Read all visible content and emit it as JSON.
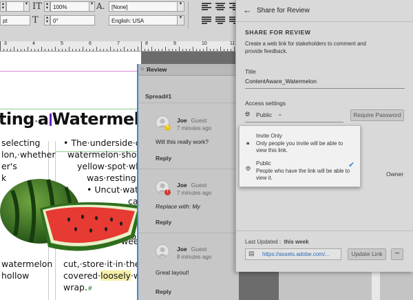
{
  "toolbar": {
    "size_value": "pt",
    "tracking_value": "100%",
    "scale_value": "100%",
    "skew_value": "0°",
    "style_value": "[None]",
    "language_value": "English: USA"
  },
  "ruler": {
    "numbers": [
      "3",
      "4",
      "5",
      "6",
      "7",
      "8",
      "9",
      "10",
      "11",
      "12"
    ]
  },
  "document": {
    "headline_left": "ting",
    "headline_mid": "a",
    "headline_right": "Watermelon",
    "col1": [
      "selecting",
      "lon,·whether",
      "er's",
      "k",
      "watermelon",
      "hollow"
    ],
    "col2": [
      "• The·underside·of·th",
      "watermelon·should",
      "yellow·spot·where",
      "was·resting·on",
      "• Uncut·water",
      "ca",
      "tem",
      "mo",
      "fo",
      "wee",
      "cut,·store·it·in·the·re",
      "covered",
      "loosely",
      "with",
      "wrap."
    ]
  },
  "review": {
    "title": "Review",
    "spread": "Spread#1",
    "comments": [
      {
        "name": "Joe",
        "role": "Guest",
        "time": "7 minutes ago",
        "text": "Will this really work?",
        "reply": "Reply"
      },
      {
        "name": "Joe",
        "role": "Guest",
        "time": "7 minutes ago",
        "text": "Replace with: My",
        "reply": "Reply"
      },
      {
        "name": "Joe",
        "role": "Guest",
        "time": "8 minutes ago",
        "text": "Great layout!",
        "reply": "Reply"
      }
    ]
  },
  "share": {
    "header_title": "Share for Review",
    "section_title": "SHARE FOR REVIEW",
    "description": "Create a web link for stakeholders to comment and provide feedback.",
    "title_label": "Title",
    "title_value": "ContentAware_Watermelon",
    "access_label": "Access settings",
    "access_value": "Public",
    "require_password": "Require Password",
    "owner": "Owner",
    "last_updated_label": "Last Updated :",
    "last_updated_value": "this week",
    "link_url": "https://assets.adobe.com/...",
    "update_link": "Update Link",
    "more": "•••",
    "options": [
      {
        "title": "Invite Only",
        "desc": "Only people you invite will be able to view this link.",
        "icon": "lock-icon"
      },
      {
        "title": "Public",
        "desc": "People who have the link will be able to view it.",
        "icon": "globe-icon",
        "selected": true
      }
    ]
  },
  "colors": {
    "accent": "#3d84d6",
    "frame_green": "#8fce8f",
    "highlight": "#f6f0a8"
  }
}
